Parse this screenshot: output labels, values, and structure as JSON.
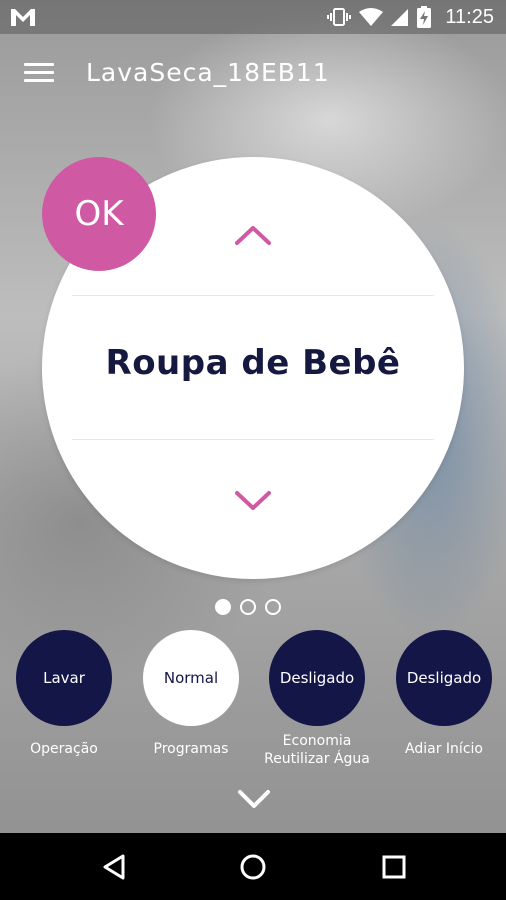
{
  "status_bar": {
    "time": "11:25",
    "left_icon": "gmail-icon",
    "right_icons": [
      "vibrate-icon",
      "wifi-icon",
      "signal-icon",
      "battery-charging-icon"
    ]
  },
  "app_bar": {
    "title": "LavaSeca_18EB11",
    "menu_icon": "hamburger-menu-icon"
  },
  "dial": {
    "program_name": "Roupa de Bebê",
    "ok_label": "OK",
    "up_icon": "chevron-up-icon",
    "down_icon": "chevron-down-icon"
  },
  "pager": {
    "count": 3,
    "active_index": 0
  },
  "controls": [
    {
      "value": "Lavar",
      "label": "Operação",
      "style": "dark"
    },
    {
      "value": "Normal",
      "label": "Programas",
      "style": "light"
    },
    {
      "value": "Desligado",
      "label": "Economia\nReutilizar Água",
      "style": "dark"
    },
    {
      "value": "Desligado",
      "label": "Adiar Início",
      "style": "dark"
    }
  ],
  "controls_labels": {
    "c0": "Operação",
    "c1": "Programas",
    "c2_line1": "Economia",
    "c2_line2": "Reutilizar Água",
    "c3": "Adiar Início"
  },
  "controls_values": {
    "c0": "Lavar",
    "c1": "Normal",
    "c2": "Desligado",
    "c3": "Desligado"
  },
  "colors": {
    "accent_pink": "#cf5aa3",
    "navy": "#131646",
    "text_dark": "#16193f"
  },
  "nav_bar": {
    "back_icon": "back-triangle-icon",
    "home_icon": "home-circle-icon",
    "recents_icon": "recents-square-icon"
  }
}
